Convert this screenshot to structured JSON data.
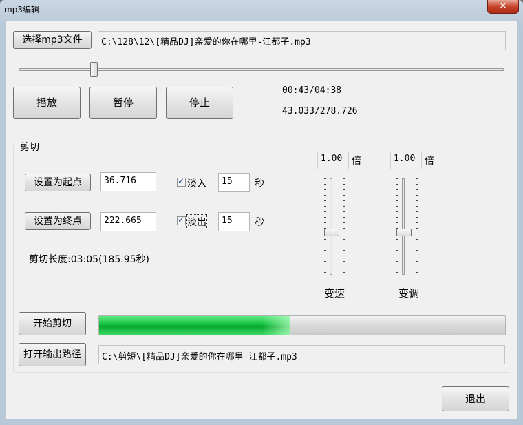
{
  "window": {
    "title": "mp3编辑",
    "close_label": "✕"
  },
  "file": {
    "select_button": "选择mp3文件",
    "path": "C:\\128\\12\\[精品DJ]亲爱的你在哪里-江都子.mp3"
  },
  "playback": {
    "seek_fraction": 0.1543,
    "play_button": "播放",
    "pause_button": "暂停",
    "stop_button": "停止",
    "time_display": "00:43/04:38",
    "seconds_display": "43.033/278.726"
  },
  "cut": {
    "group_label": "剪切",
    "set_start_button": "设置为起点",
    "start_value": "36.716",
    "set_end_button": "设置为终点",
    "end_value": "222.665",
    "fade_in": {
      "label": "淡入",
      "checked": true,
      "value": "15",
      "unit": "秒"
    },
    "fade_out": {
      "label": "淡出",
      "checked": true,
      "value": "15",
      "unit": "秒"
    },
    "length_text": "剪切长度:03:05(185.95秒)"
  },
  "speed": {
    "value": "1.00",
    "unit": "倍",
    "label": "变速",
    "level": 0.5
  },
  "pitch": {
    "value": "1.00",
    "unit": "倍",
    "label": "变调",
    "level": 0.5
  },
  "output": {
    "start_cut_button": "开始剪切",
    "progress_fraction": 0.47,
    "open_output_button": "打开输出路径",
    "output_path": "C:\\剪短\\[精品DJ]亲爱的你在哪里-江都子.mp3"
  },
  "footer": {
    "exit_button": "退出"
  },
  "colors": {
    "progress_green": "#12c13e",
    "close_red": "#c7432b",
    "client_bg": "#f0f0f0"
  }
}
